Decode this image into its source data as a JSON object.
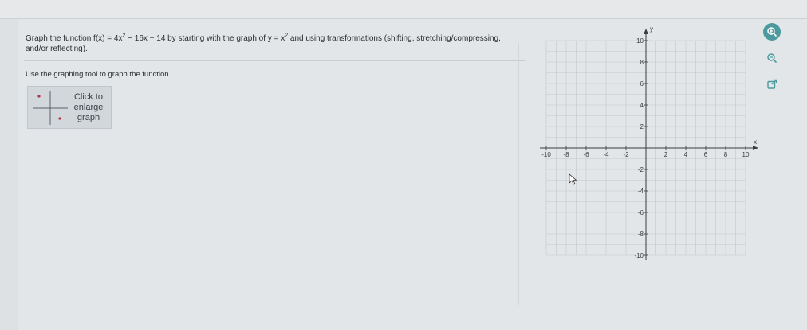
{
  "question": {
    "text_before": "Graph the function f(x) = 4x",
    "exp1": "2",
    "text_mid": " − 16x + 14 by starting with the graph of y = x",
    "exp2": "2",
    "text_after": " and using transformations (shifting, stretching/compressing, and/or reflecting)."
  },
  "instruction": "Use the graphing tool to graph the function.",
  "enlarge_button": {
    "line1": "Click to",
    "line2": "enlarge",
    "line3": "graph"
  },
  "graph": {
    "x_axis_label": "x",
    "y_axis_label": "y",
    "x_ticks": [
      "-10",
      "-8",
      "-6",
      "-4",
      "-2",
      "2",
      "4",
      "6",
      "8",
      "10"
    ],
    "y_ticks": [
      "10",
      "8",
      "6",
      "4",
      "2",
      "-2",
      "-4",
      "-6",
      "-8",
      "-10"
    ],
    "xlim": [
      -10,
      10
    ],
    "ylim": [
      -10,
      10
    ],
    "grid": true
  },
  "tools": [
    "zoom-in-icon",
    "zoom-out-icon",
    "popout-icon"
  ],
  "colors": {
    "accent": "#4c9a9e",
    "grid": "#c4c8cc",
    "axis": "#3a3c40"
  }
}
